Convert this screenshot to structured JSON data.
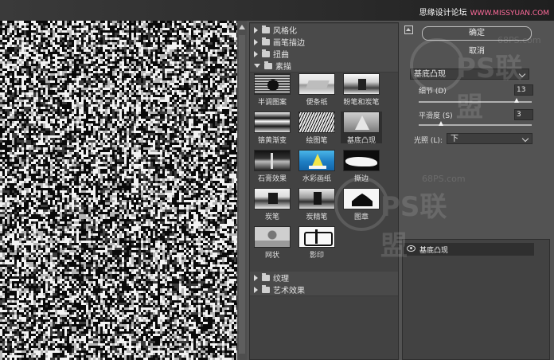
{
  "site_credit": {
    "text": "思缘设计论坛",
    "domain": "WWW.MISSYUAN.COM"
  },
  "gallery": {
    "folders": [
      {
        "label": "风格化",
        "open": false
      },
      {
        "label": "画笔描边",
        "open": false
      },
      {
        "label": "扭曲",
        "open": false
      },
      {
        "label": "素描",
        "open": true
      },
      {
        "label": "纹理",
        "open": false
      },
      {
        "label": "艺术效果",
        "open": false
      }
    ],
    "sketch_filters": [
      {
        "label": "半调图案",
        "selected": false
      },
      {
        "label": "便条纸",
        "selected": false
      },
      {
        "label": "粉笔和炭笔",
        "selected": false
      },
      {
        "label": "铬黄渐变",
        "selected": false
      },
      {
        "label": "绘图笔",
        "selected": false
      },
      {
        "label": "基底凸现",
        "selected": true
      },
      {
        "label": "石膏效果",
        "selected": false
      },
      {
        "label": "水彩画纸",
        "selected": false
      },
      {
        "label": "撕边",
        "selected": false
      },
      {
        "label": "炭笔",
        "selected": false
      },
      {
        "label": "炭精笔",
        "selected": false
      },
      {
        "label": "图章",
        "selected": false
      },
      {
        "label": "网状",
        "selected": false
      },
      {
        "label": "影印",
        "selected": false
      }
    ]
  },
  "panel": {
    "ok_label": "确定",
    "cancel_label": "取消",
    "filter_select": "基底凸现",
    "detail_label": "细节 (D)",
    "detail_value": "13",
    "detail_max": 15,
    "smooth_label": "平滑度 (S)",
    "smooth_value": "3",
    "smooth_max": 15,
    "light_label": "光照 (L):",
    "light_value": "下"
  },
  "layers": {
    "items": [
      {
        "name": "基底凸现",
        "visible": true
      }
    ]
  },
  "watermark": {
    "logo_text": "PS联盟",
    "url": "68PS.com"
  }
}
